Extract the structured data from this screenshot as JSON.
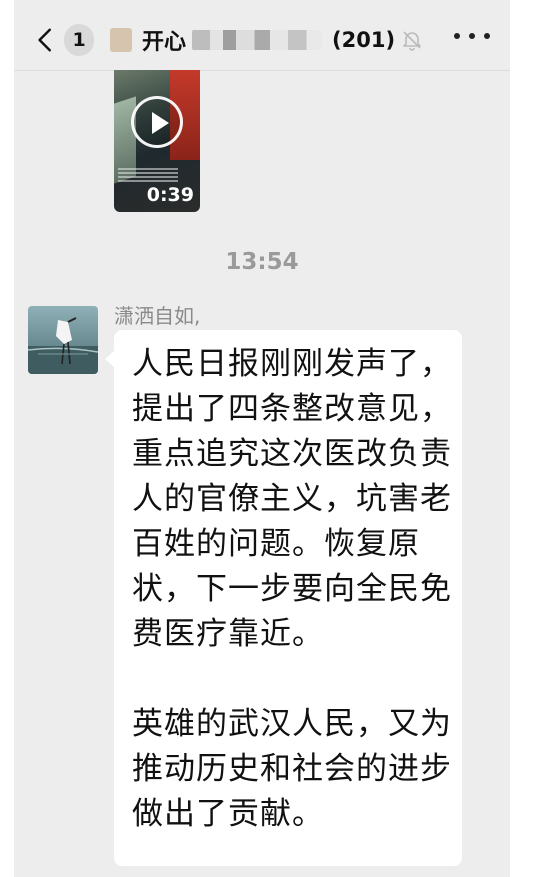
{
  "header": {
    "back_badge": "1",
    "title": "开心",
    "member_count": "(201)"
  },
  "video": {
    "duration": "0:39"
  },
  "timestamp": "13:54",
  "message": {
    "sender": "潇洒自如,",
    "paragraph1": "人民日报刚刚发声了，提出了四条整改意见，重点追究这次医改负责人的官僚主义，坑害老百姓的问题。恢复原状，下一步要向全民免费医疗靠近。",
    "paragraph2": "英雄的武汉人民，又为推动历史和社会的进步做出了贡献。"
  }
}
